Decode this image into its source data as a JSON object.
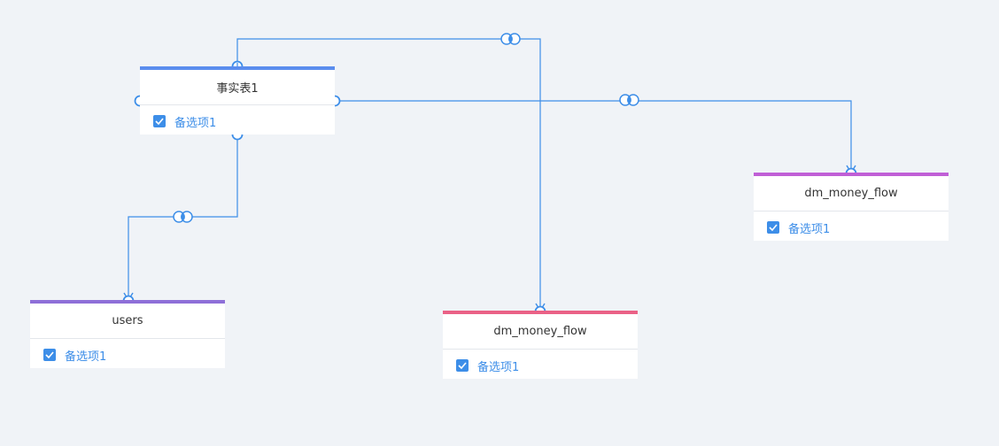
{
  "nodes": {
    "fact": {
      "title": "事实表1",
      "option": "备选项1",
      "color": "#5b8dee"
    },
    "users": {
      "title": "users",
      "option": "备选项1",
      "color": "#8e6fd8"
    },
    "dm1": {
      "title": "dm_money_flow",
      "option": "备选项1",
      "color": "#ea6186"
    },
    "dm2": {
      "title": "dm_money_flow",
      "option": "备选项1",
      "color": "#c05fd6"
    }
  },
  "edges": [
    {
      "from": "事实表1",
      "to": "users",
      "join_icon": "join-venn-icon"
    },
    {
      "from": "事实表1",
      "to": "dm_money_flow",
      "join_icon": "join-venn-icon"
    },
    {
      "from": "事实表1",
      "to": "dm_money_flow",
      "join_icon": "join-venn-icon"
    }
  ],
  "colors": {
    "edge": "#3d8ee8",
    "background": "#f0f3f7",
    "checkbox": "#3d8ee8"
  }
}
